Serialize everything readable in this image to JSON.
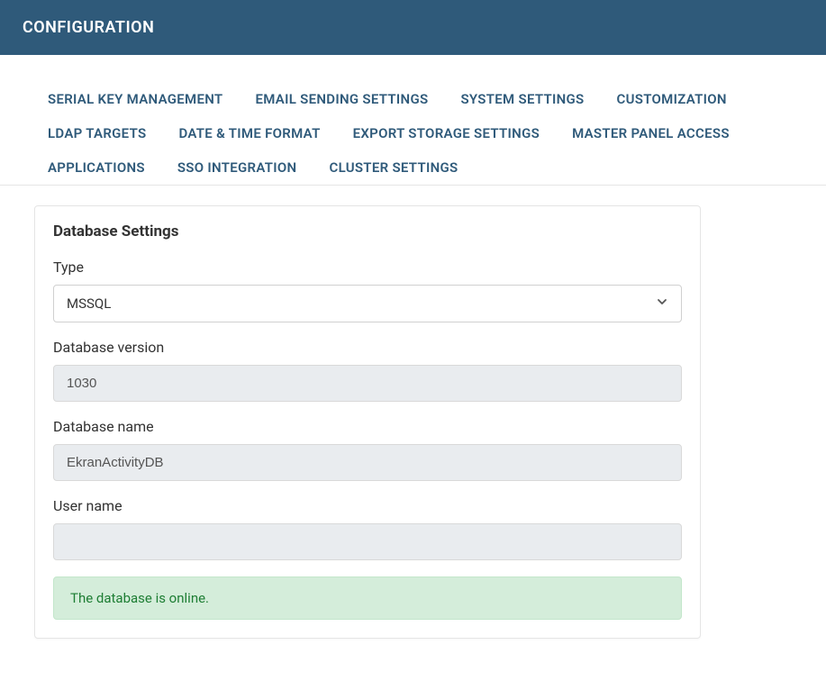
{
  "header": {
    "title": "CONFIGURATION"
  },
  "tabs": [
    {
      "label": "SERIAL KEY MANAGEMENT"
    },
    {
      "label": "EMAIL SENDING SETTINGS"
    },
    {
      "label": "SYSTEM SETTINGS"
    },
    {
      "label": "CUSTOMIZATION"
    },
    {
      "label": "LDAP TARGETS"
    },
    {
      "label": "DATE & TIME FORMAT"
    },
    {
      "label": "EXPORT STORAGE SETTINGS"
    },
    {
      "label": "MASTER PANEL ACCESS"
    },
    {
      "label": "APPLICATIONS"
    },
    {
      "label": "SSO INTEGRATION"
    },
    {
      "label": "CLUSTER SETTINGS"
    }
  ],
  "card": {
    "title": "Database Settings",
    "type_label": "Type",
    "type_value": "MSSQL",
    "version_label": "Database version",
    "version_value": "1030",
    "name_label": "Database name",
    "name_value": "EkranActivityDB",
    "user_label": "User name",
    "user_value": "",
    "status_message": "The database is online."
  }
}
